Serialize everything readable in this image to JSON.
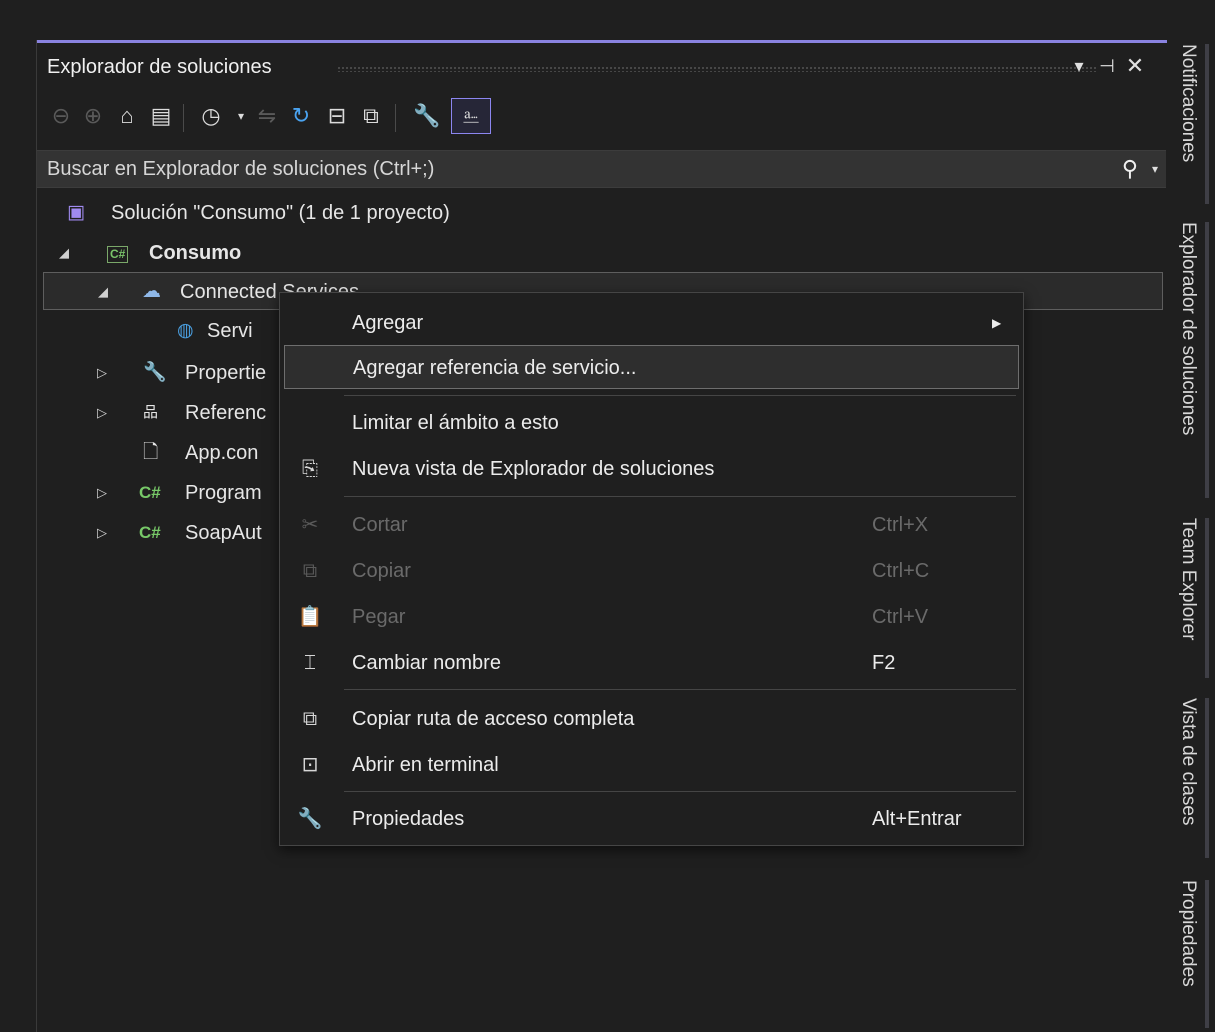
{
  "panel": {
    "title": "Explorador de soluciones",
    "controls": {
      "dropdown": "▾",
      "pin": "⊣",
      "close": "✕"
    }
  },
  "toolbar": {
    "icons": [
      "back-icon",
      "forward-icon",
      "home-icon",
      "switch-views-icon",
      "pending-changes-filter-icon",
      "sync-icon",
      "refresh-icon",
      "collapse-all-icon",
      "show-all-files-icon",
      "properties-icon",
      "preview-selected-icon"
    ]
  },
  "search": {
    "placeholder": "Buscar en Explorador de soluciones (Ctrl+;)"
  },
  "tree": {
    "solution": "Solución \"Consumo\"  (1 de 1 proyecto)",
    "project": "Consumo",
    "project_badge": "C#",
    "connected_services": "Connected Services",
    "service_ref": "Servi",
    "properties": "Propertie",
    "references": "Referenc",
    "app_config": "App.con",
    "program": "Program",
    "soap": "SoapAut",
    "cs_label": "C#"
  },
  "context_menu": {
    "items": [
      {
        "label": "Agregar",
        "shortcut": "",
        "submenu": true
      },
      {
        "label": "Agregar referencia de servicio...",
        "shortcut": ""
      },
      {
        "label": "Limitar el ámbito a esto",
        "shortcut": ""
      },
      {
        "label": "Nueva vista de Explorador de soluciones",
        "shortcut": ""
      },
      {
        "label": "Cortar",
        "shortcut": "Ctrl+X",
        "disabled": true
      },
      {
        "label": "Copiar",
        "shortcut": "Ctrl+C",
        "disabled": true
      },
      {
        "label": "Pegar",
        "shortcut": "Ctrl+V",
        "disabled": true
      },
      {
        "label": "Cambiar nombre",
        "shortcut": "F2"
      },
      {
        "label": "Copiar ruta de acceso completa",
        "shortcut": ""
      },
      {
        "label": "Abrir en terminal",
        "shortcut": ""
      },
      {
        "label": "Propiedades",
        "shortcut": "Alt+Entrar"
      }
    ]
  },
  "dock_tabs": [
    "Notificaciones",
    "Explorador de soluciones",
    "Team Explorer",
    "Vista de clases",
    "Propiedades"
  ],
  "colors": {
    "accent": "#8a83e0",
    "csharp": "#77c868",
    "background": "#1f1f1f"
  }
}
